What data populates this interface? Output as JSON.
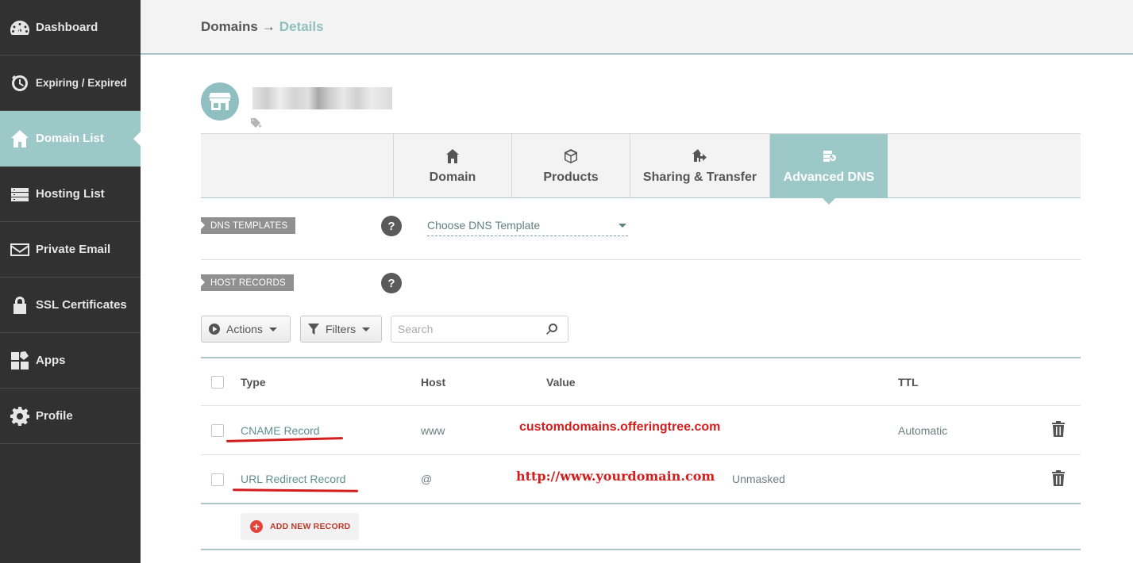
{
  "sidebar": {
    "items": [
      {
        "label": "Dashboard",
        "icon": "dashboard-icon"
      },
      {
        "label": "Expiring / Expired",
        "icon": "timer-icon"
      },
      {
        "label": "Domain List",
        "icon": "home-icon",
        "active": true
      },
      {
        "label": "Hosting List",
        "icon": "server-icon"
      },
      {
        "label": "Private Email",
        "icon": "envelope-icon"
      },
      {
        "label": "SSL Certificates",
        "icon": "lock-icon"
      },
      {
        "label": "Apps",
        "icon": "apps-icon"
      },
      {
        "label": "Profile",
        "icon": "gear-icon"
      }
    ]
  },
  "breadcrumb": {
    "root": "Domains",
    "arrow": "→",
    "current": "Details"
  },
  "tabs": [
    {
      "label": "Domain",
      "icon": "home-icon"
    },
    {
      "label": "Products",
      "icon": "box-icon"
    },
    {
      "label": "Sharing & Transfer",
      "icon": "house-transfer-icon"
    },
    {
      "label": "Advanced DNS",
      "icon": "dns-server-icon",
      "active": true
    }
  ],
  "dns_templates": {
    "label": "DNS TEMPLATES",
    "help": "?",
    "select_value": "Choose DNS Template"
  },
  "host_records": {
    "label": "HOST RECORDS",
    "help": "?"
  },
  "toolbar": {
    "actions_label": "Actions",
    "filters_label": "Filters",
    "search_placeholder": "Search"
  },
  "table": {
    "headers": {
      "type": "Type",
      "host": "Host",
      "value": "Value",
      "ttl": "TTL"
    },
    "rows": [
      {
        "type": "CNAME Record",
        "host": "www",
        "value": "customdomains.offeringtree.com",
        "ttl": "Automatic"
      },
      {
        "type": "URL Redirect Record",
        "host": "@",
        "value": "http://www.yourdomain.com",
        "extra": "Unmasked"
      }
    ]
  },
  "add_record": {
    "plus": "+",
    "label": "ADD NEW RECORD"
  },
  "colors": {
    "accent": "#9cc8c8",
    "sidebar": "#313131",
    "annotation_red": "#d31e1e"
  }
}
